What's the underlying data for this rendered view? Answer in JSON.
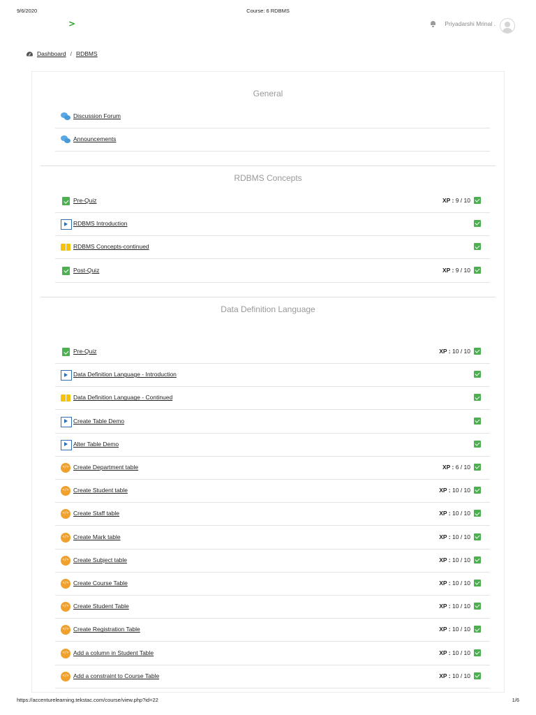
{
  "print_header": {
    "date": "9/6/2020",
    "title": "Course: 6 RDBMS"
  },
  "print_footer": {
    "url": "https://accenturelearning.tekstac.com/course/view.php?id=22",
    "page": "1/6"
  },
  "logo": {
    "glyph": ">",
    "color": "#2aa12a"
  },
  "user": {
    "name": "Priyadarshi Mrinal .",
    "notification_icon": "bell-icon",
    "avatar_icon": "user-avatar-icon"
  },
  "breadcrumb": {
    "icon": "dashboard-gauge-icon",
    "items": [
      "Dashboard",
      "RDBMS"
    ],
    "separator": "/"
  },
  "colors": {
    "complete": "#4cb050",
    "video": "#2e70b6",
    "book": "#f5c30c",
    "code": "#f0a02c",
    "forum": "#5aa9e6"
  },
  "sections": [
    {
      "title": "General",
      "activities": [
        {
          "type": "forum",
          "name": "Discussion Forum",
          "xp": "",
          "complete": false
        },
        {
          "type": "forum",
          "name": "Announcements",
          "xp": "",
          "complete": false
        }
      ]
    },
    {
      "title": "RDBMS Concepts",
      "activities": [
        {
          "type": "quiz",
          "name": "Pre-Quiz",
          "xp": "9 / 10",
          "complete": true
        },
        {
          "type": "video",
          "name": "RDBMS Introduction",
          "xp": "",
          "complete": true
        },
        {
          "type": "book",
          "name": "RDBMS Concepts-continued",
          "xp": "",
          "complete": true
        },
        {
          "type": "quiz",
          "name": "Post-Quiz",
          "xp": "9 / 10",
          "complete": true
        }
      ]
    },
    {
      "title": "Data Definition Language",
      "activities": [
        {
          "type": "quiz",
          "name": "Pre-Quiz",
          "xp": "10 / 10",
          "complete": true
        },
        {
          "type": "video",
          "name": "Data Definition Language - Introduction",
          "xp": "",
          "complete": true
        },
        {
          "type": "book",
          "name": "Data Definition Language - Continued",
          "xp": "",
          "complete": true
        },
        {
          "type": "video",
          "name": "Create Table Demo",
          "xp": "",
          "complete": true
        },
        {
          "type": "video",
          "name": "Alter Table Demo",
          "xp": "",
          "complete": true
        },
        {
          "type": "code",
          "name": "Create Department table",
          "xp": "6 / 10",
          "complete": true
        },
        {
          "type": "code",
          "name": "Create Student table",
          "xp": "10 / 10",
          "complete": true
        },
        {
          "type": "code",
          "name": "Create Staff table",
          "xp": "10 / 10",
          "complete": true
        },
        {
          "type": "code",
          "name": "Create Mark table",
          "xp": "10 / 10",
          "complete": true
        },
        {
          "type": "code",
          "name": "Create Subject table",
          "xp": "10 / 10",
          "complete": true
        },
        {
          "type": "code",
          "name": "Create Course Table",
          "xp": "10 / 10",
          "complete": true
        },
        {
          "type": "code",
          "name": "Create Student Table",
          "xp": "10 / 10",
          "complete": true
        },
        {
          "type": "code",
          "name": "Create Registration Table",
          "xp": "10 / 10",
          "complete": true
        },
        {
          "type": "code",
          "name": "Add a column in Student Table",
          "xp": "10 / 10",
          "complete": true
        },
        {
          "type": "code",
          "name": "Add a constraint to Course Table",
          "xp": "10 / 10",
          "complete": true
        }
      ]
    }
  ],
  "xp_label": "XP :"
}
